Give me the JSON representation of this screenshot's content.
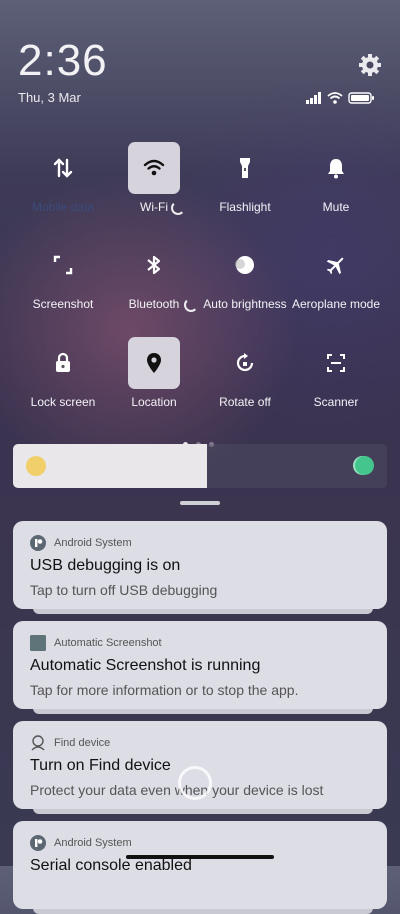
{
  "status": {
    "time": "2:36",
    "date": "Thu, 3 Mar",
    "icons": [
      "signal-icon",
      "wifi-icon",
      "battery-icon"
    ],
    "settings_icon": "gear-icon"
  },
  "quick_settings": {
    "tiles": [
      {
        "label": "Mobile data",
        "icon": "mobile-data-icon",
        "on": false
      },
      {
        "label": "Wi-Fi",
        "icon": "wifi-icon",
        "on": true
      },
      {
        "label": "Flashlight",
        "icon": "flashlight-icon",
        "on": false
      },
      {
        "label": "Mute",
        "icon": "bell-icon",
        "on": false
      },
      {
        "label": "Screenshot",
        "icon": "screenshot-icon",
        "on": false
      },
      {
        "label": "Bluetooth",
        "icon": "bluetooth-icon",
        "on": false
      },
      {
        "label": "Auto brightness",
        "icon": "auto-brightness-icon",
        "on": false
      },
      {
        "label": "Aeroplane mode",
        "icon": "airplane-icon",
        "on": false
      },
      {
        "label": "Lock screen",
        "icon": "lock-icon",
        "on": false
      },
      {
        "label": "Location",
        "icon": "location-icon",
        "on": true
      },
      {
        "label": "Rotate off",
        "icon": "rotate-icon",
        "on": false
      },
      {
        "label": "Scanner",
        "icon": "scanner-icon",
        "on": false
      }
    ],
    "page_count": 3,
    "active_page": 1
  },
  "brightness": {
    "level": 0.52
  },
  "notifications": [
    {
      "app": "Android System",
      "icon": "android-system-icon",
      "title": "USB debugging is on",
      "body": "Tap to turn off USB debugging"
    },
    {
      "app": "Automatic Screenshot",
      "icon": "screenshot-app-icon",
      "title": "Automatic Screenshot is running",
      "body": "Tap for more information or to stop the app."
    },
    {
      "app": "Find device",
      "icon": "find-device-icon",
      "title": "Turn on Find device",
      "body": "Protect your data even when your device is lost"
    },
    {
      "app": "Android System",
      "icon": "android-system-icon",
      "title": "Serial console enabled",
      "body": ""
    }
  ],
  "colors": {
    "accent_toggle": "#45c58e",
    "sun": "#f1cf6a",
    "tile_on": "#d7d3dd"
  }
}
